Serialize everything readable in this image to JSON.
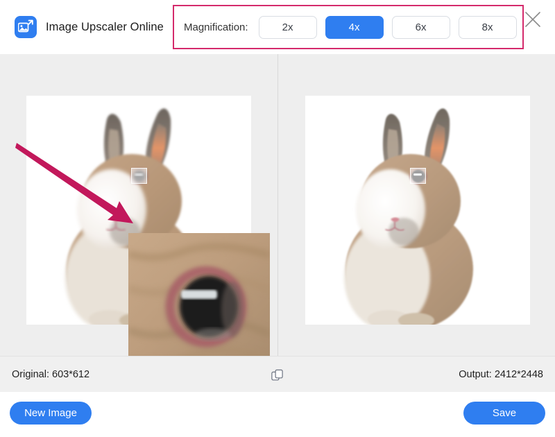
{
  "app": {
    "title": "Image Upscaler Online",
    "logo_icon": "image-upscale-icon",
    "close_icon": "close-icon"
  },
  "magnification": {
    "label": "Magnification:",
    "selected": "4x",
    "options": [
      {
        "label": "2x",
        "active": false
      },
      {
        "label": "4x",
        "active": true
      },
      {
        "label": "6x",
        "active": false
      },
      {
        "label": "8x",
        "active": false
      }
    ],
    "highlight_color": "#d42a6b",
    "accent_color": "#2f7ef0"
  },
  "compare": {
    "left_pane_name": "original-preview",
    "right_pane_name": "upscaled-preview",
    "subject": "rabbit",
    "annotation_arrow_color": "#c2185b",
    "magnifier_label": "eye-region-selection"
  },
  "info": {
    "original": "Original: 603*612",
    "output": "Output: 2412*2448",
    "compare_icon": "copy-compare-icon"
  },
  "footer": {
    "new_image_label": "New Image",
    "save_label": "Save"
  }
}
